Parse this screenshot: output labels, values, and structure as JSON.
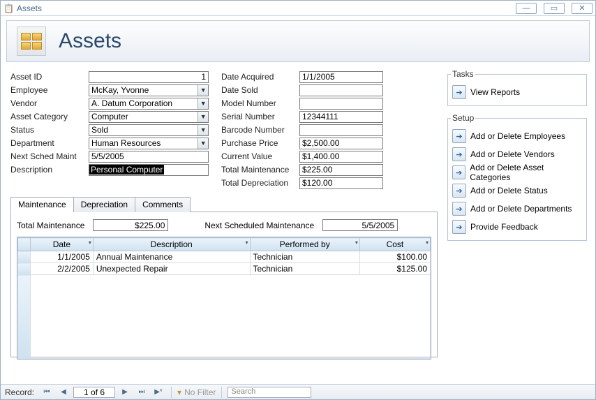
{
  "window": {
    "title": "Assets"
  },
  "header": {
    "title": "Assets"
  },
  "fields_left": {
    "asset_id": {
      "label": "Asset ID",
      "value": "1"
    },
    "employee": {
      "label": "Employee",
      "value": "McKay, Yvonne"
    },
    "vendor": {
      "label": "Vendor",
      "value": "A. Datum Corporation"
    },
    "category": {
      "label": "Asset Category",
      "value": "Computer"
    },
    "status": {
      "label": "Status",
      "value": "Sold"
    },
    "department": {
      "label": "Department",
      "value": "Human Resources"
    },
    "next_sched": {
      "label": "Next Sched Maint",
      "value": "5/5/2005"
    },
    "description": {
      "label": "Description",
      "value": "Personal Computer"
    }
  },
  "fields_right": {
    "date_acquired": {
      "label": "Date Acquired",
      "value": "1/1/2005"
    },
    "date_sold": {
      "label": "Date Sold",
      "value": ""
    },
    "model_number": {
      "label": "Model Number",
      "value": ""
    },
    "serial_number": {
      "label": "Serial Number",
      "value": "12344111"
    },
    "barcode": {
      "label": "Barcode Number",
      "value": ""
    },
    "purchase_price": {
      "label": "Purchase Price",
      "value": "$2,500.00"
    },
    "current_value": {
      "label": "Current Value",
      "value": "$1,400.00"
    },
    "total_maint": {
      "label": "Total Maintenance",
      "value": "$225.00"
    },
    "total_depr": {
      "label": "Total Depreciation",
      "value": "$120.00"
    }
  },
  "tabs": {
    "maintenance": "Maintenance",
    "depreciation": "Depreciation",
    "comments": "Comments"
  },
  "maint_tab": {
    "total_label": "Total Maintenance",
    "total_value": "$225.00",
    "next_label": "Next Scheduled Maintenance",
    "next_value": "5/5/2005",
    "columns": {
      "date": "Date",
      "desc": "Description",
      "perf": "Performed by",
      "cost": "Cost"
    },
    "rows": [
      {
        "date": "1/1/2005",
        "desc": "Annual Maintenance",
        "perf": "Technician",
        "cost": "$100.00"
      },
      {
        "date": "2/2/2005",
        "desc": "Unexpected Repair",
        "perf": "Technician",
        "cost": "$125.00"
      }
    ]
  },
  "tasks": {
    "legend": "Tasks",
    "view_reports": "View Reports"
  },
  "setup": {
    "legend": "Setup",
    "items": [
      "Add or Delete Employees",
      "Add or Delete Vendors",
      "Add or Delete Asset Categories",
      "Add or Delete Status",
      "Add or Delete Departments",
      "Provide Feedback"
    ]
  },
  "nav": {
    "record_label": "Record:",
    "position": "1 of 6",
    "no_filter": "No Filter",
    "search": "Search"
  }
}
